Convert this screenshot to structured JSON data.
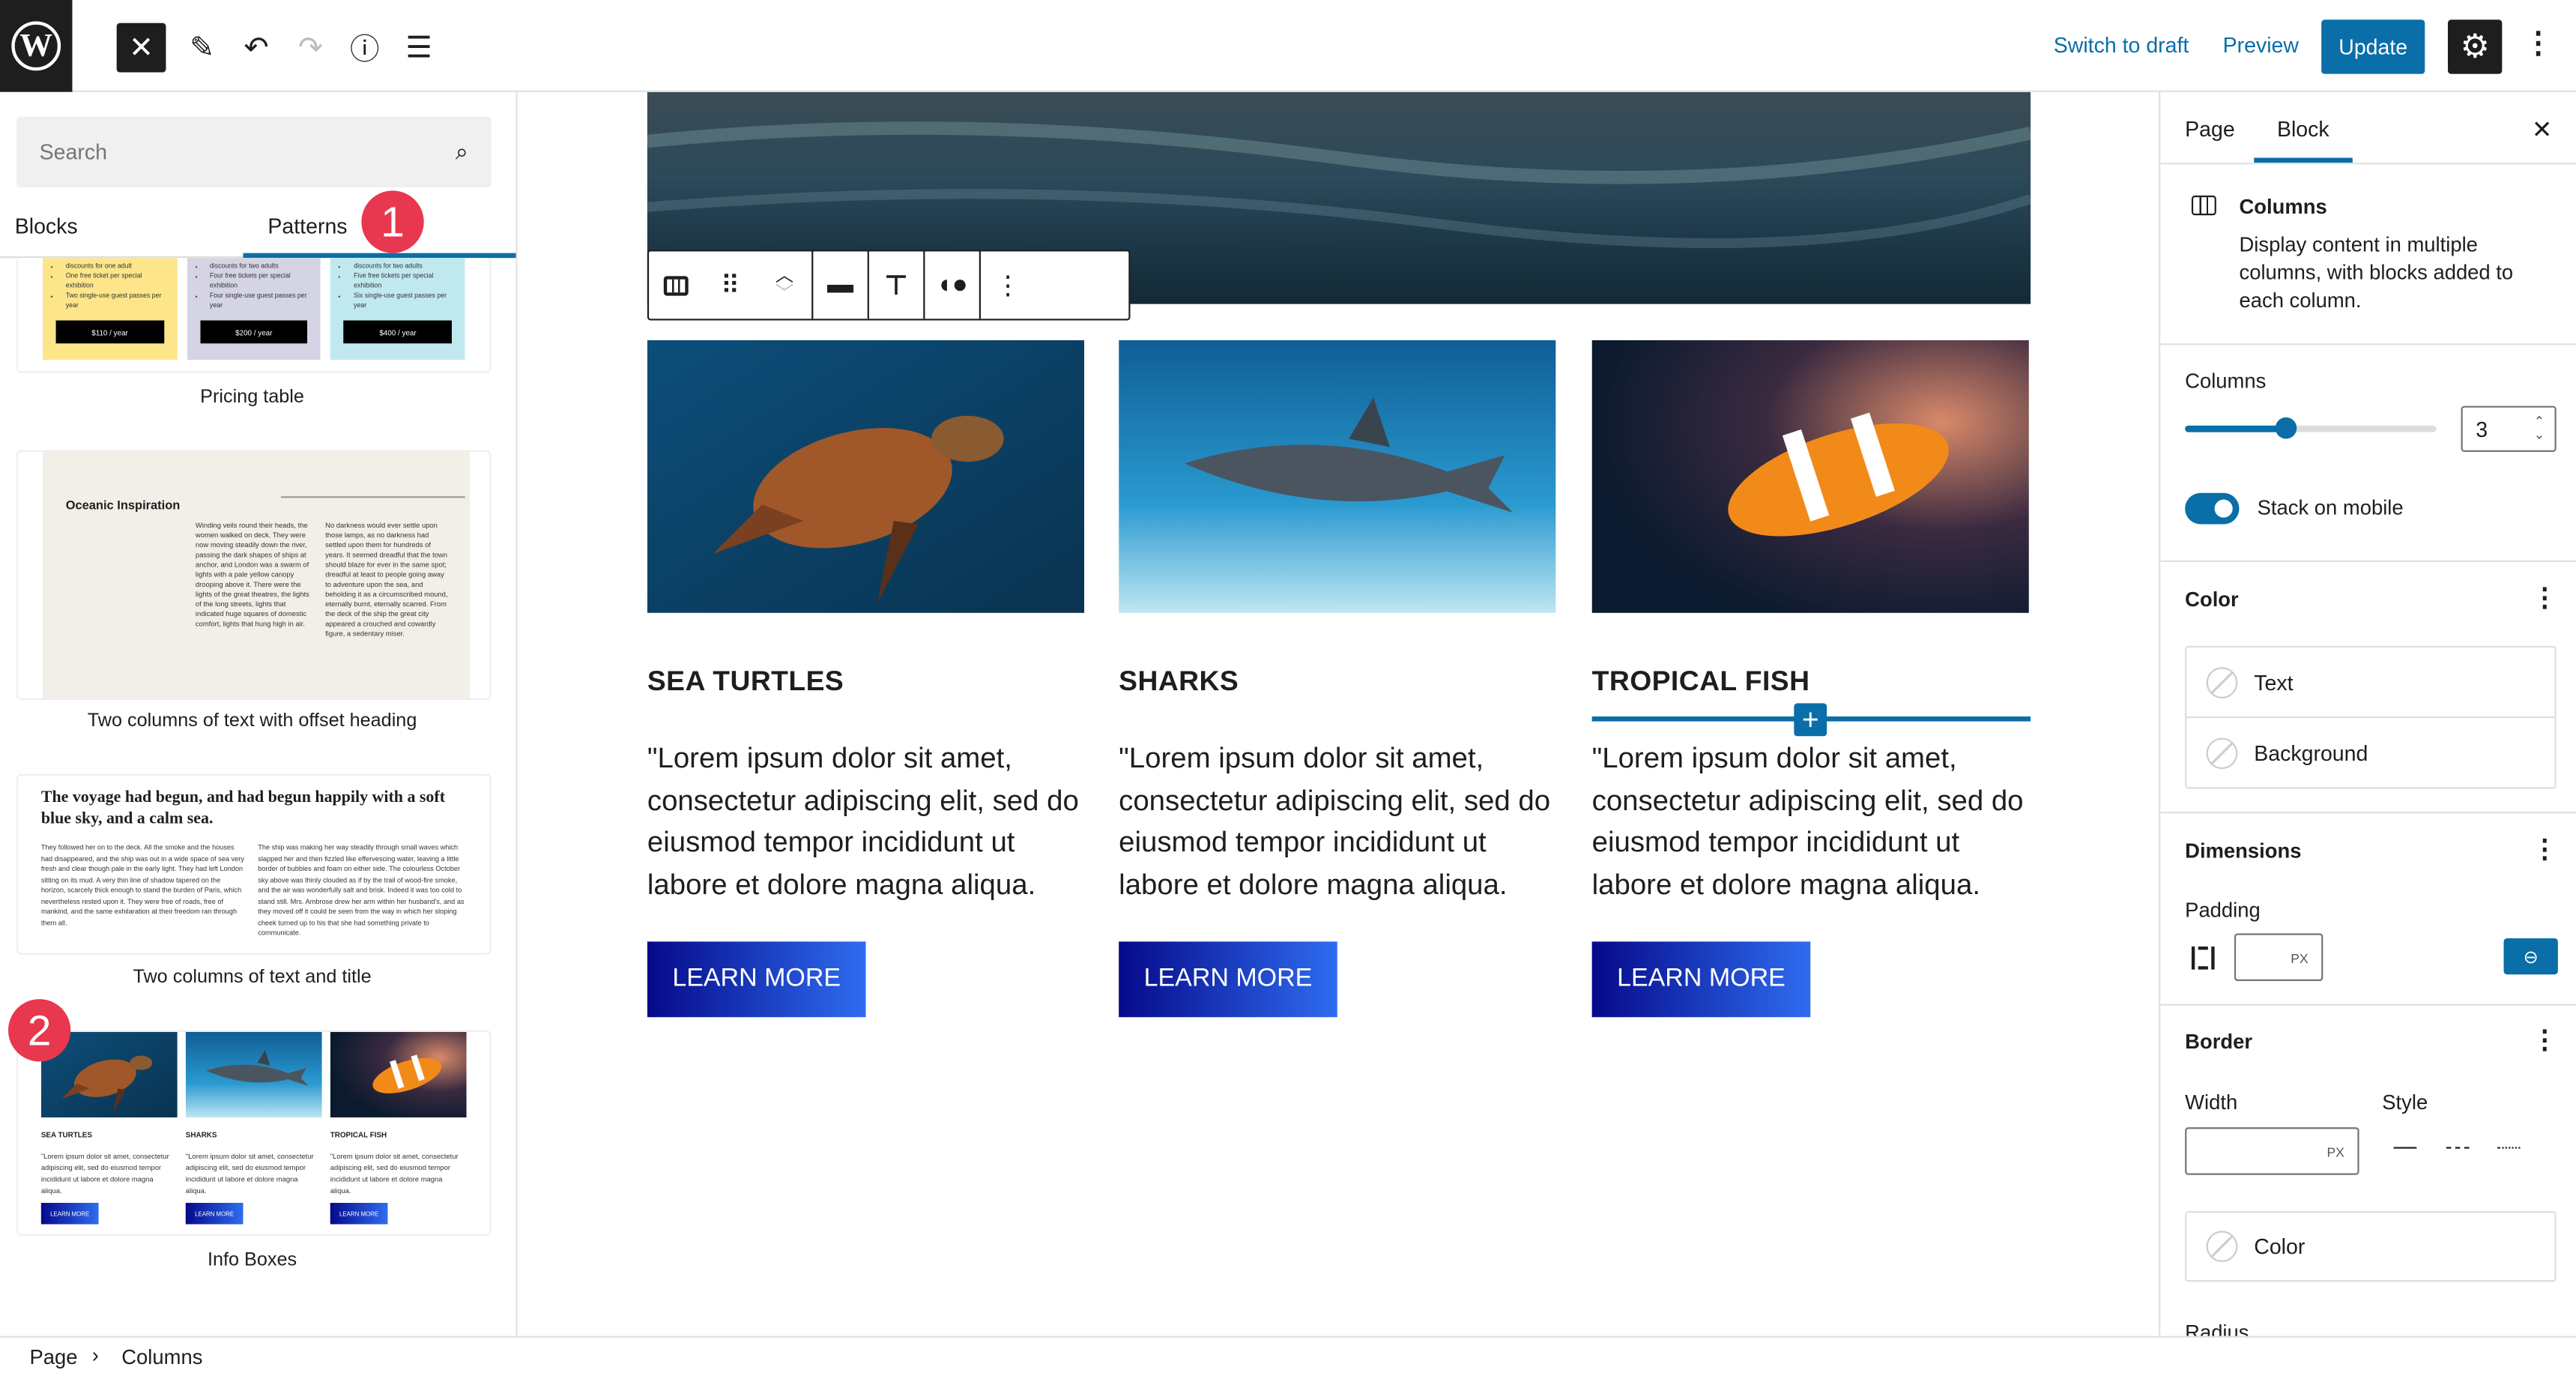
{
  "header": {
    "switch_draft": "Switch to draft",
    "preview": "Preview",
    "update": "Update",
    "logo": "W"
  },
  "inserter": {
    "search_placeholder": "Search",
    "tabs": [
      "Blocks",
      "Patterns"
    ],
    "badges": [
      "1",
      "2"
    ],
    "pricing": {
      "items": [
        [
          "discounts for one adult",
          "One free ticket per special exhibition",
          "Two single-use guest passes per year"
        ],
        [
          "discounts for two adults",
          "Four free tickets per special exhibition",
          "Four single-use guest passes per year"
        ],
        [
          "discounts for two adults",
          "Five free tickets per special exhibition",
          "Six single-use guest passes per year"
        ]
      ],
      "prices": [
        "$110 / year",
        "$200 / year",
        "$400 / year"
      ],
      "colors": [
        "#fde68a",
        "#d4d4e4",
        "#c0e8ef"
      ]
    },
    "patterns": [
      {
        "label": "Pricing table"
      },
      {
        "label": "Two columns of text with offset heading",
        "heading": "Oceanic Inspiration",
        "col1": "Winding veils round their heads, the women walked on deck. They were now moving steadily down the river, passing the dark shapes of ships at anchor, and London was a swarm of lights with a pale yellow canopy drooping above it. There were the lights of the great theatres, the lights of the long streets, lights that indicated huge squares of domestic comfort, lights that hung high in air.",
        "col2": "No darkness would ever settle upon those lamps, as no darkness had settled upon them for hundreds of years. It seemed dreadful that the town should blaze for ever in the same spot; dreadful at least to people going away to adventure upon the sea, and beholding it as a circumscribed mound, eternally burnt, eternally scarred. From the deck of the ship the great city appeared a crouched and cowardly figure, a sedentary miser."
      },
      {
        "label": "Two columns of text and title",
        "heading": "The voyage had begun, and had begun happily with a soft blue sky, and a calm sea.",
        "col1": "They followed her on to the deck. All the smoke and the houses had disappeared, and the ship was out in a wide space of sea very fresh and clear though pale in the early light. They had left London sitting on its mud. A very thin line of shadow tapered on the horizon, scarcely thick enough to stand the burden of Paris, which nevertheless rested upon it. They were free of roads, free of mankind, and the same exhilaration at their freedom ran through them all.",
        "col2": "The ship was making her way steadily through small waves which slapped her and then fizzled like effervescing water, leaving a little border of bubbles and foam on either side. The colourless October sky above was thinly clouded as if by the trail of wood-fire smoke, and the air was wonderfully salt and brisk. Indeed it was too cold to stand still. Mrs. Ambrose drew her arm within her husband's, and as they moved off it could be seen from the way in which her sloping cheek turned up to his that she had something private to communicate."
      },
      {
        "label": "Info Boxes"
      }
    ]
  },
  "canvas": {
    "columns": [
      {
        "title": "SEA TURTLES",
        "text": "\"Lorem ipsum dolor sit amet, consectetur adipiscing elit, sed do eiusmod tempor incididunt ut labore et dolore magna aliqua.",
        "button": "LEARN MORE",
        "image": "sea-turtle"
      },
      {
        "title": "SHARKS",
        "text": "\"Lorem ipsum dolor sit amet, consectetur adipiscing elit, sed do eiusmod tempor incididunt ut labore et dolore magna aliqua.",
        "button": "LEARN MORE",
        "image": "shark"
      },
      {
        "title": "TROPICAL FISH",
        "text": "\"Lorem ipsum dolor sit amet, consectetur adipiscing elit, sed do eiusmod tempor incididunt ut labore et dolore magna aliqua.",
        "button": "LEARN MORE",
        "image": "clownfish"
      }
    ]
  },
  "sidebar": {
    "tabs": [
      "Page",
      "Block"
    ],
    "block": {
      "name": "Columns",
      "description": "Display content in multiple columns, with blocks added to each column."
    },
    "columns": {
      "label": "Columns",
      "value": "3",
      "slider_fraction": 0.4,
      "stack_label": "Stack on mobile",
      "stack_on": true
    },
    "color": {
      "title": "Color",
      "items": [
        "Text",
        "Background"
      ]
    },
    "dimensions": {
      "title": "Dimensions",
      "padding_label": "Padding",
      "unit": "PX"
    },
    "border": {
      "title": "Border",
      "width_label": "Width",
      "style_label": "Style",
      "unit": "PX",
      "color_label": "Color",
      "radius_label": "Radius"
    }
  },
  "breadcrumb": [
    "Page",
    "Columns"
  ],
  "colors": {
    "accent": "#0a6ea8",
    "badge": "#e8384f"
  }
}
